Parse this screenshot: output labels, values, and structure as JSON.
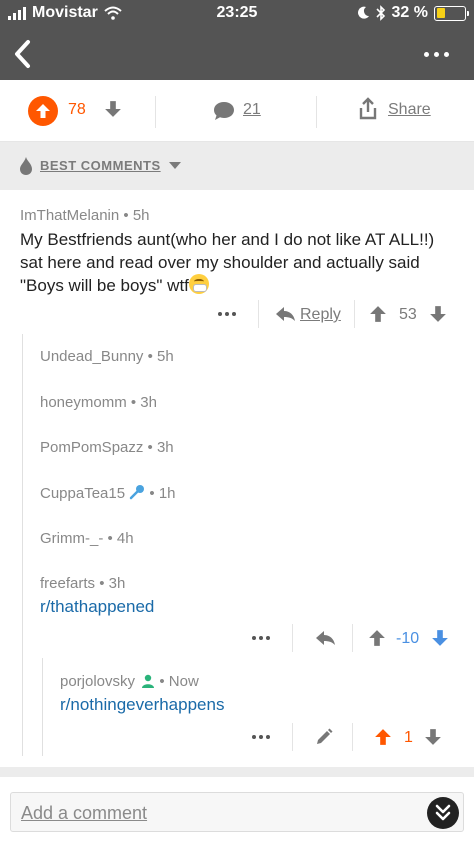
{
  "status_bar": {
    "carrier": "Movistar",
    "time": "23:25",
    "battery": "32 %",
    "battery_level": 0.32
  },
  "nav": {
    "back_icon": "chevron-left-icon",
    "more_icon": "more-dots-icon"
  },
  "post_actions": {
    "score": "78",
    "comments": "21",
    "share": "Share"
  },
  "sort": {
    "label": "BEST COMMENTS"
  },
  "comments": [
    {
      "author": "ImThatMelanin",
      "age": "5h",
      "body": "My Bestfriends aunt(who her and I do not like AT ALL!!) sat here and read over my shoulder and actually said \"Boys will be boys\" wtf",
      "reply": "Reply",
      "score": "53"
    },
    {
      "author": "Undead_Bunny",
      "age": "5h"
    },
    {
      "author": "honeymomm",
      "age": "3h"
    },
    {
      "author": "PomPomSpazz",
      "age": "3h"
    },
    {
      "author": "CuppaTea15",
      "age": "1h"
    },
    {
      "author": "Grimm-_-",
      "age": "4h"
    },
    {
      "author": "freefarts",
      "age": "3h",
      "body": "r/thathappened",
      "score": "-10"
    },
    {
      "author": "porjolovsky",
      "age": "Now",
      "body": "r/nothingeverhappens",
      "score": "1"
    }
  ],
  "composer": {
    "placeholder": "Add a comment"
  },
  "colors": {
    "upvote": "#ff5700",
    "downvote": "#4a90e2",
    "link": "#1a6aa8"
  }
}
